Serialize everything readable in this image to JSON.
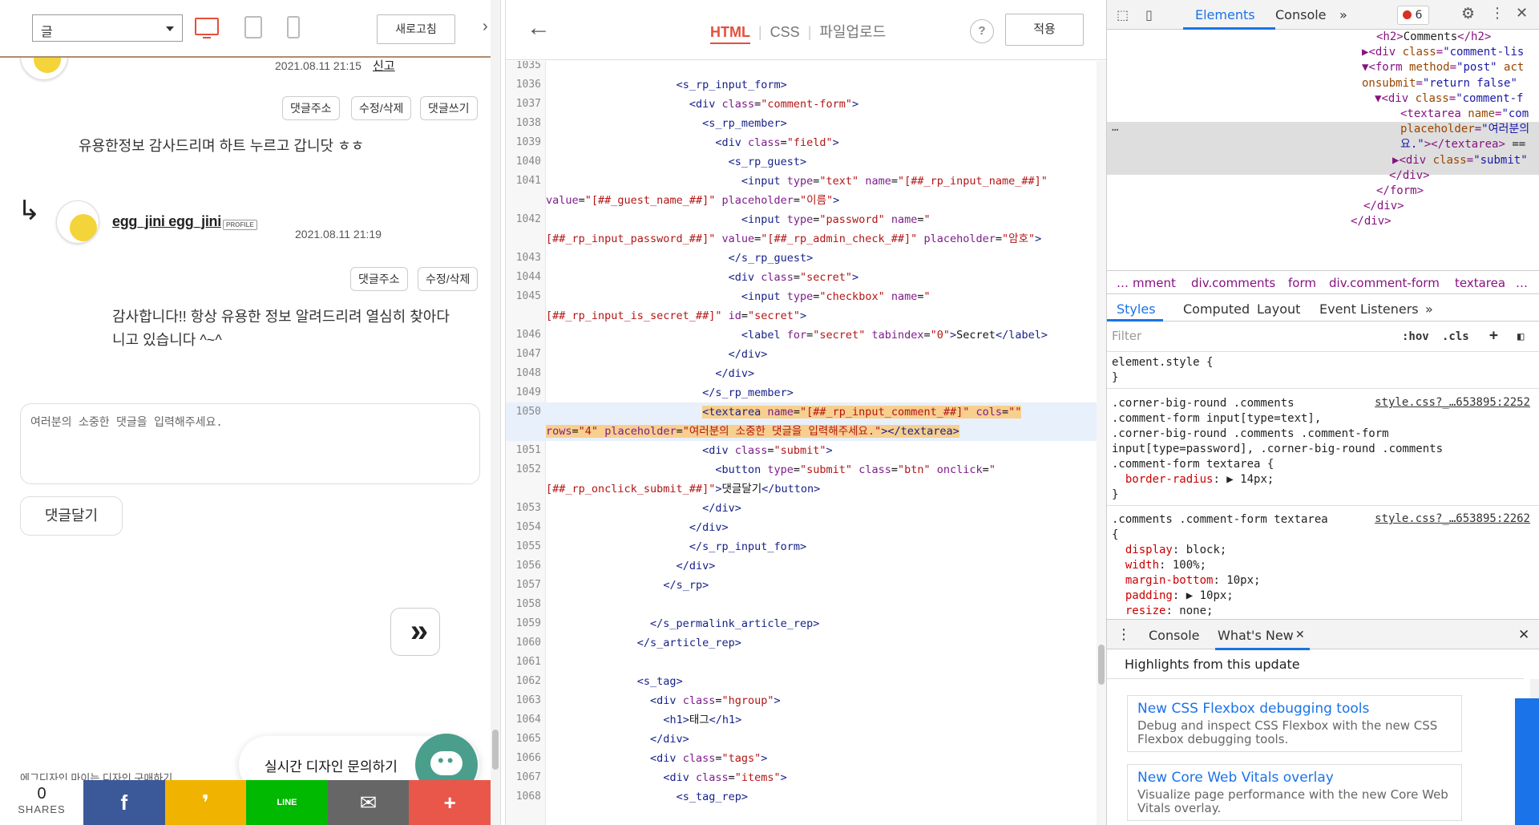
{
  "preview": {
    "view_select": "글",
    "refresh_label": "새로고침",
    "first_comment": {
      "date": "2021.08.11 21:15",
      "report": "신고",
      "actions": [
        "댓글주소",
        "수정/삭제",
        "댓글쓰기"
      ],
      "text": "유용한정보 감사드리며 하트 누르고 갑니닷 ㅎㅎ"
    },
    "reply": {
      "arrow": "↳",
      "author": "egg_jini egg_jini",
      "badge": "PROFILE",
      "date": "2021.08.11 21:19",
      "actions": [
        "댓글주소",
        "수정/삭제"
      ],
      "text_line1": "감사합니다!! 항상 유용한 정보 알려드리려 열심히 찾아다",
      "text_line2": "니고 있습니다 ^~^"
    },
    "comment_placeholder": "여러분의 소중한 댓글을 입력해주세요.",
    "submit_label": "댓글달기",
    "forward_glyph": "»",
    "chat_label": "실시간 디자인 문의하기",
    "footer_links": "에그디자인      마이는 디자인 구매하기",
    "share": {
      "count": "0",
      "label": "SHARES",
      "buttons": [
        {
          "glyph": "f",
          "color": "#3b5998"
        },
        {
          "glyph": "❜",
          "color": "#f0b400"
        },
        {
          "glyph": "LINE",
          "color": "#00b900"
        },
        {
          "glyph": "✉",
          "color": "#666666"
        },
        {
          "glyph": "+",
          "color": "#e9574a"
        }
      ]
    }
  },
  "editor": {
    "back": "←",
    "tabs": [
      "HTML",
      "CSS",
      "파일업로드"
    ],
    "help": "?",
    "apply_label": "적용",
    "lines": [
      {
        "n": "1035",
        "html": ""
      },
      {
        "n": "1036",
        "html": "                    <span class=\"tag\">&lt;s_rp_input_form&gt;</span>"
      },
      {
        "n": "1037",
        "html": "                      <span class=\"tag\">&lt;div</span> <span class=\"attr\">class</span>=<span class=\"val\">\"comment-form\"</span><span class=\"tag\">&gt;</span>"
      },
      {
        "n": "1038",
        "html": "                        <span class=\"tag\">&lt;s_rp_member&gt;</span>"
      },
      {
        "n": "1039",
        "html": "                          <span class=\"tag\">&lt;div</span> <span class=\"attr\">class</span>=<span class=\"val\">\"field\"</span><span class=\"tag\">&gt;</span>"
      },
      {
        "n": "1040",
        "html": "                            <span class=\"tag\">&lt;s_rp_guest&gt;</span>"
      },
      {
        "n": "1041",
        "html": "                              <span class=\"tag\">&lt;input</span> <span class=\"attr\">type</span>=<span class=\"val\">\"text\"</span> <span class=\"attr\">name</span>=<span class=\"val\">\"[##_rp_input_name_##]\"</span>"
      },
      {
        "n": "",
        "html": "<span class=\"attr\">value</span>=<span class=\"val\">\"[##_guest_name_##]\"</span> <span class=\"attr\">placeholder</span>=<span class=\"val\">\"이름\"</span><span class=\"tag\">&gt;</span>"
      },
      {
        "n": "1042",
        "html": "                              <span class=\"tag\">&lt;input</span> <span class=\"attr\">type</span>=<span class=\"val\">\"password\"</span> <span class=\"attr\">name</span>=<span class=\"val\">\"</span>"
      },
      {
        "n": "",
        "html": "<span class=\"val\">[##_rp_input_password_##]\"</span> <span class=\"attr\">value</span>=<span class=\"val\">\"[##_rp_admin_check_##]\"</span> <span class=\"attr\">placeholder</span>=<span class=\"val\">\"암호\"</span><span class=\"tag\">&gt;</span>"
      },
      {
        "n": "1043",
        "html": "                            <span class=\"tag\">&lt;/s_rp_guest&gt;</span>"
      },
      {
        "n": "1044",
        "html": "                            <span class=\"tag\">&lt;div</span> <span class=\"attr\">class</span>=<span class=\"val\">\"secret\"</span><span class=\"tag\">&gt;</span>"
      },
      {
        "n": "1045",
        "html": "                              <span class=\"tag\">&lt;input</span> <span class=\"attr\">type</span>=<span class=\"val\">\"checkbox\"</span> <span class=\"attr\">name</span>=<span class=\"val\">\"</span>"
      },
      {
        "n": "",
        "html": "<span class=\"val\">[##_rp_input_is_secret_##]\"</span> <span class=\"attr\">id</span>=<span class=\"val\">\"secret\"</span><span class=\"tag\">&gt;</span>"
      },
      {
        "n": "1046",
        "html": "                              <span class=\"tag\">&lt;label</span> <span class=\"attr\">for</span>=<span class=\"val\">\"secret\"</span> <span class=\"attr\">tabindex</span>=<span class=\"val\">\"0\"</span><span class=\"tag\">&gt;</span>Secret<span class=\"tag\">&lt;/label&gt;</span>"
      },
      {
        "n": "1047",
        "html": "                            <span class=\"tag\">&lt;/div&gt;</span>"
      },
      {
        "n": "1048",
        "html": "                          <span class=\"tag\">&lt;/div&gt;</span>"
      },
      {
        "n": "1049",
        "html": "                        <span class=\"tag\">&lt;/s_rp_member&gt;</span>"
      },
      {
        "n": "1050",
        "html": "                        <span class=\"selmark\"><span class=\"tag\">&lt;textarea</span> <span class=\"attr\">name</span>=<span class=\"val\">\"[##_rp_input_comment_##]\"</span> <span class=\"attr\">cols</span>=<span class=\"val\">\"\"</span></span>",
        "hl": true
      },
      {
        "n": "",
        "html": "<span class=\"selmark\"><span class=\"attr\">rows</span>=<span class=\"val\">\"4\"</span> <span class=\"attr\">placeholder</span>=<span class=\"val\">\"여러분의 소중한 댓글을 입력해주세요.\"</span><span class=\"tag\">&gt;&lt;/textarea&gt;</span></span>",
        "hl": true
      },
      {
        "n": "1051",
        "html": "                        <span class=\"tag\">&lt;div</span> <span class=\"attr\">class</span>=<span class=\"val\">\"submit\"</span><span class=\"tag\">&gt;</span>"
      },
      {
        "n": "1052",
        "html": "                          <span class=\"tag\">&lt;button</span> <span class=\"attr\">type</span>=<span class=\"val\">\"submit\"</span> <span class=\"attr\">class</span>=<span class=\"val\">\"btn\"</span> <span class=\"attr\">onclick</span>=<span class=\"val\">\"</span>"
      },
      {
        "n": "",
        "html": "<span class=\"val\">[##_rp_onclick_submit_##]\"</span><span class=\"tag\">&gt;</span>댓글달기<span class=\"tag\">&lt;/button&gt;</span>"
      },
      {
        "n": "1053",
        "html": "                        <span class=\"tag\">&lt;/div&gt;</span>"
      },
      {
        "n": "1054",
        "html": "                      <span class=\"tag\">&lt;/div&gt;</span>"
      },
      {
        "n": "1055",
        "html": "                      <span class=\"tag\">&lt;/s_rp_input_form&gt;</span>"
      },
      {
        "n": "1056",
        "html": "                    <span class=\"tag\">&lt;/div&gt;</span>"
      },
      {
        "n": "1057",
        "html": "                  <span class=\"tag\">&lt;/s_rp&gt;</span>"
      },
      {
        "n": "1058",
        "html": ""
      },
      {
        "n": "1059",
        "html": "                <span class=\"tag\">&lt;/s_permalink_article_rep&gt;</span>"
      },
      {
        "n": "1060",
        "html": "              <span class=\"tag\">&lt;/s_article_rep&gt;</span>"
      },
      {
        "n": "1061",
        "html": ""
      },
      {
        "n": "1062",
        "html": "              <span class=\"tag\">&lt;s_tag&gt;</span>"
      },
      {
        "n": "1063",
        "html": "                <span class=\"tag\">&lt;div</span> <span class=\"attr\">class</span>=<span class=\"val\">\"hgroup\"</span><span class=\"tag\">&gt;</span>"
      },
      {
        "n": "1064",
        "html": "                  <span class=\"tag\">&lt;h1&gt;</span>태그<span class=\"tag\">&lt;/h1&gt;</span>"
      },
      {
        "n": "1065",
        "html": "                <span class=\"tag\">&lt;/div&gt;</span>"
      },
      {
        "n": "1066",
        "html": "                <span class=\"tag\">&lt;div</span> <span class=\"attr\">class</span>=<span class=\"val\">\"tags\"</span><span class=\"tag\">&gt;</span>"
      },
      {
        "n": "1067",
        "html": "                  <span class=\"tag\">&lt;div</span> <span class=\"attr\">class</span>=<span class=\"val\">\"items\"</span><span class=\"tag\">&gt;</span>"
      },
      {
        "n": "1068",
        "html": "                    <span class=\"tag\">&lt;s_tag_rep&gt;</span>"
      }
    ]
  },
  "devtools": {
    "tabs": [
      "Elements",
      "Console"
    ],
    "more": "»",
    "error_count": "6",
    "dom_lines": [
      {
        "i": 5,
        "html": "<span class=\"d-tag\">&lt;h2&gt;</span><span class=\"d-txt\">Comments</span><span class=\"d-tag\">&lt;/h2&gt;</span>"
      },
      {
        "i": 4,
        "html": "▶<span class=\"d-tag\">&lt;div </span><span class=\"d-attr\">class</span>=<span class=\"d-val\">\"comment-lis</span>"
      },
      {
        "i": 4,
        "html": "▼<span class=\"d-tag\">&lt;form </span><span class=\"d-attr\">method</span>=<span class=\"d-val\">\"post\"</span> <span class=\"d-attr\">act</span>"
      },
      {
        "i": 0,
        "html": "<span class=\"d-attr\">onsubmit</span>=<span class=\"d-val\">\"return false\"</span>"
      },
      {
        "i": 2,
        "html": "▼<span class=\"d-tag\">&lt;div </span><span class=\"d-attr\">class</span>=<span class=\"d-val\">\"comment-f</span>"
      },
      {
        "i": 6,
        "html": "<span class=\"d-tag\">&lt;textarea </span><span class=\"d-attr\">name</span>=<span class=\"d-val\">\"com</span>"
      },
      {
        "i": 6,
        "html": "<span class=\"d-attr\">placeholder</span>=<span class=\"d-val\">\"여러분의</span>"
      },
      {
        "i": 6,
        "html": "<span class=\"d-val\">요.\"</span><span class=\"d-tag\">&gt;&lt;/textarea&gt;</span> <span class=\"d-txt\">==</span>"
      },
      {
        "i": 5,
        "html": "▶<span class=\"d-tag\">&lt;div </span><span class=\"d-attr\">class</span>=<span class=\"d-val\">\"submit\"</span>"
      },
      {
        "i": 4,
        "html": "<span class=\"d-tag\">&lt;/div&gt;</span>"
      },
      {
        "i": 3,
        "html": "<span class=\"d-tag\">&lt;/form&gt;</span>"
      },
      {
        "i": 2,
        "html": "<span class=\"d-tag\">&lt;/div&gt;</span>"
      },
      {
        "i": 1,
        "html": "<span class=\"d-tag\">&lt;/div&gt;</span>"
      }
    ],
    "breadcrumbs": [
      "…",
      "mment",
      "div.comments",
      "form",
      "div.comment-form",
      "textarea",
      "…"
    ],
    "style_tabs": [
      "Styles",
      "Computed",
      "Layout",
      "Event Listeners",
      "»"
    ],
    "filter_placeholder": "Filter",
    "hov": ":hov",
    "cls": ".cls",
    "rules": {
      "element_style": "element.style {",
      "element_close": "}",
      "r1_link": "style.css?_…653895:2252",
      "r1_sel1": ".corner-big-round .comments",
      "r1_sel2": ".comment-form input[type=text],",
      "r1_sel3": ".corner-big-round .comments .comment-form",
      "r1_sel4": "input[type=password], .corner-big-round .comments",
      "r1_sel5": ".comment-form textarea {",
      "r1_prop": "border-radius",
      "r1_val": ": ▶ 14px;",
      "r1_close": "}",
      "r2_link": "style.css?_…653895:2262",
      "r2_sel": ".comments .comment-form textarea",
      "r2_open": "{",
      "r2_p1": "display",
      "r2_v1": ": block;",
      "r2_p2": "width",
      "r2_v2": ": 100%;",
      "r2_p3": "margin-bottom",
      "r2_v3": ": 10px;",
      "r2_p4": "padding",
      "r2_v4": ": ▶ 10px;",
      "r2_p5": "resize",
      "r2_v5": ": none;"
    },
    "drawer_tabs": [
      "Console",
      "What's New"
    ],
    "whats_new": {
      "title": "Highlights from this update",
      "cards": [
        {
          "heading": "New CSS Flexbox debugging tools",
          "desc": "Debug and inspect CSS Flexbox with the new CSS Flexbox debugging tools."
        },
        {
          "heading": "New Core Web Vitals overlay",
          "desc": "Visualize page performance with the new Core Web Vitals overlay."
        }
      ]
    }
  }
}
